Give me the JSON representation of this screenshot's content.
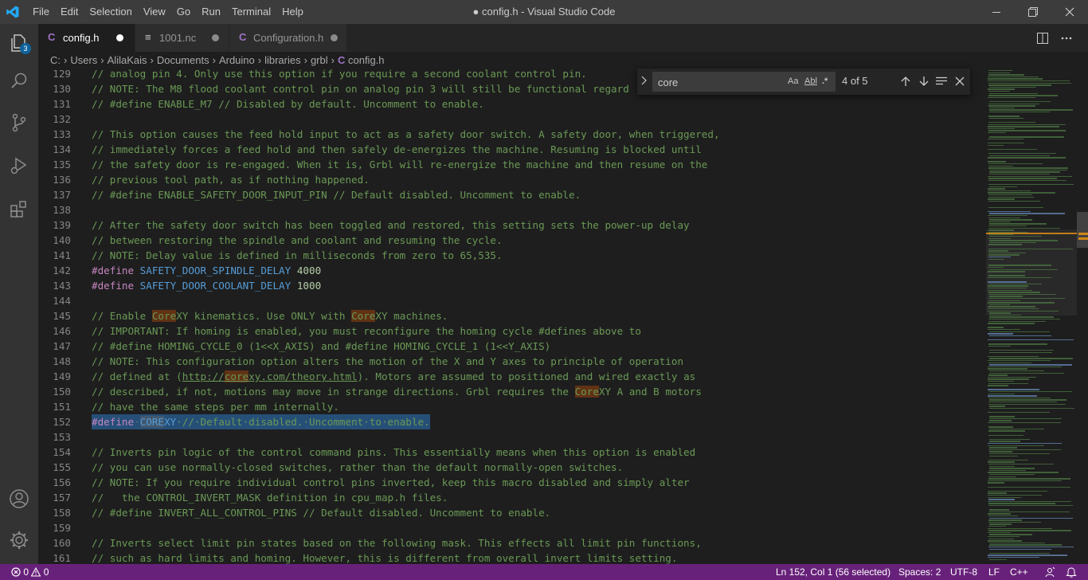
{
  "app": {
    "menu": [
      "File",
      "Edit",
      "Selection",
      "View",
      "Go",
      "Run",
      "Terminal",
      "Help"
    ],
    "window_title": "● config.h - Visual Studio Code"
  },
  "activity_bar": {
    "items": [
      "explorer-icon",
      "search-icon",
      "source-control-icon",
      "run-debug-icon",
      "extensions-icon"
    ],
    "explorer_badge": "3",
    "bottom": [
      "account-icon",
      "settings-gear-icon"
    ]
  },
  "tabs": [
    {
      "label": "config.h",
      "icon": "C",
      "icon_color": "#a074c4",
      "active": true,
      "dirty": true
    },
    {
      "label": "1001.nc",
      "icon": "≡",
      "icon_color": "#cccccc",
      "active": false,
      "dirty": true
    },
    {
      "label": "Configuration.h",
      "icon": "C",
      "icon_color": "#a074c4",
      "active": false,
      "dirty": true
    }
  ],
  "breadcrumb": [
    "C:",
    "Users",
    "AlilaKais",
    "Documents",
    "Arduino",
    "libraries",
    "grbl",
    "config.h"
  ],
  "find_widget": {
    "query": "core",
    "match_case": "Aa",
    "whole_word": "Abl",
    "regex": ".*",
    "result": "4 of 5"
  },
  "editor": {
    "lines": [
      {
        "n": "129",
        "text": "// analog pin 4. Only use this option if you require a second coolant control pin."
      },
      {
        "n": "130",
        "text": "// NOTE: The M8 flood coolant control pin on analog pin 3 will still be functional regard"
      },
      {
        "n": "131",
        "text": "// #define ENABLE_M7 // Disabled by default. Uncomment to enable."
      },
      {
        "n": "132",
        "text": ""
      },
      {
        "n": "133",
        "text": "// This option causes the feed hold input to act as a safety door switch. A safety door, when triggered,"
      },
      {
        "n": "134",
        "text": "// immediately forces a feed hold and then safely de-energizes the machine. Resuming is blocked until"
      },
      {
        "n": "135",
        "text": "// the safety door is re-engaged. When it is, Grbl will re-energize the machine and then resume on the"
      },
      {
        "n": "136",
        "text": "// previous tool path, as if nothing happened."
      },
      {
        "n": "137",
        "text": "// #define ENABLE_SAFETY_DOOR_INPUT_PIN // Default disabled. Uncomment to enable."
      },
      {
        "n": "138",
        "text": ""
      },
      {
        "n": "139",
        "text": "// After the safety door switch has been toggled and restored, this setting sets the power-up delay"
      },
      {
        "n": "140",
        "text": "// between restoring the spindle and coolant and resuming the cycle."
      },
      {
        "n": "141",
        "text": "// NOTE: Delay value is defined in milliseconds from zero to 65,535."
      },
      {
        "n": "142",
        "define": "#define",
        "macro": "SAFETY_DOOR_SPINDLE_DELAY",
        "value": "4000"
      },
      {
        "n": "143",
        "define": "#define",
        "macro": "SAFETY_DOOR_COOLANT_DELAY",
        "value": "1000"
      },
      {
        "n": "144",
        "text": ""
      },
      {
        "n": "145",
        "parts": [
          "// Enable ",
          "*Core",
          "XY kinematics. Use ONLY with ",
          "*Core",
          "XY machines."
        ]
      },
      {
        "n": "146",
        "text": "// IMPORTANT: If homing is enabled, you must reconfigure the homing cycle #defines above to"
      },
      {
        "n": "147",
        "text": "// #define HOMING_CYCLE_0 (1<<X_AXIS) and #define HOMING_CYCLE_1 (1<<Y_AXIS)"
      },
      {
        "n": "148",
        "text": "// NOTE: This configuration option alters the motion of the X and Y axes to principle of operation"
      },
      {
        "n": "149",
        "parts": [
          "// defined at (",
          "_http://",
          "*_core",
          "_xy.com/theory.html",
          "). Motors are assumed to positioned and wired exactly as"
        ]
      },
      {
        "n": "150",
        "parts": [
          "// described, if not, motions may move in strange directions. Grbl requires the ",
          "*Core",
          "XY A and B motors"
        ]
      },
      {
        "n": "151",
        "text": "// have the same steps per mm internally."
      },
      {
        "n": "152",
        "selected": true,
        "define": "#define",
        "macro_match": "CORE",
        "macro_rest": "XY",
        "comment": "·//·Default·disabled.·Uncomment·to·enable."
      },
      {
        "n": "153",
        "text": ""
      },
      {
        "n": "154",
        "text": "// Inverts pin logic of the control command pins. This essentially means when this option is enabled"
      },
      {
        "n": "155",
        "text": "// you can use normally-closed switches, rather than the default normally-open switches."
      },
      {
        "n": "156",
        "text": "// NOTE: If you require individual control pins inverted, keep this macro disabled and simply alter"
      },
      {
        "n": "157",
        "text": "//   the CONTROL_INVERT_MASK definition in cpu_map.h files."
      },
      {
        "n": "158",
        "text": "// #define INVERT_ALL_CONTROL_PINS // Default disabled. Uncomment to enable."
      },
      {
        "n": "159",
        "text": ""
      },
      {
        "n": "160",
        "text": "// Inverts select limit pin states based on the following mask. This effects all limit pin functions,"
      },
      {
        "n": "161",
        "text": "// such as hard limits and homing. However, this is different from overall invert limits setting."
      }
    ]
  },
  "status_bar": {
    "errors": "0",
    "warnings": "0",
    "position": "Ln 152, Col 1 (56 selected)",
    "indent": "Spaces: 2",
    "encoding": "UTF-8",
    "eol": "LF",
    "language": "C++"
  },
  "colors": {
    "status_bar": "#68217a",
    "selection": "#264f78",
    "find_match": "#613214",
    "comment": "#6a9955",
    "keyword": "#c586c0",
    "macro": "#569cd6",
    "number": "#b5cea8"
  }
}
